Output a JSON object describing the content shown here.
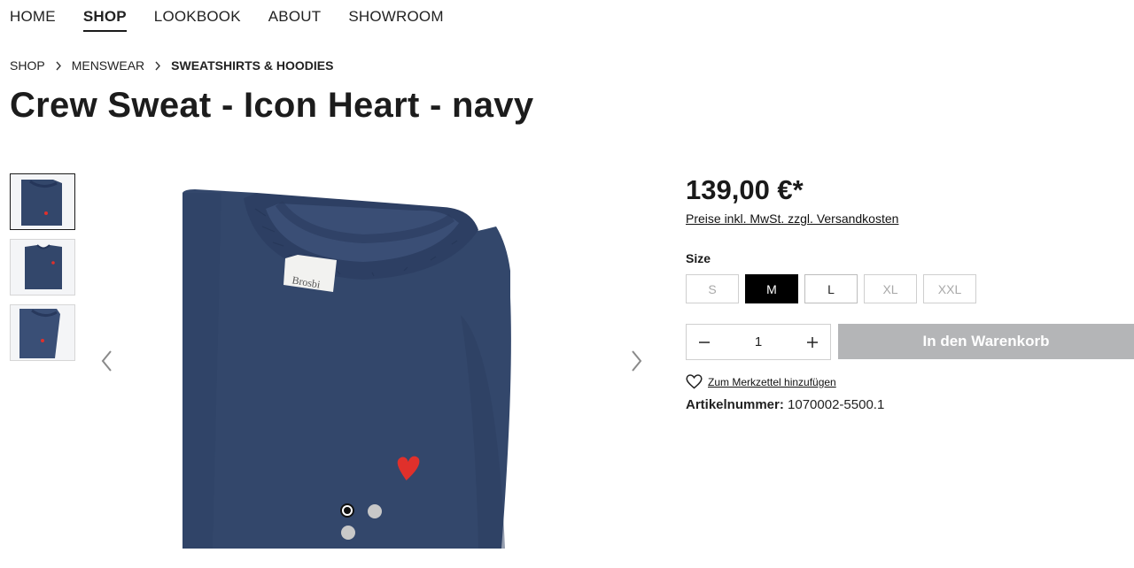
{
  "nav": {
    "items": [
      {
        "label": "HOME"
      },
      {
        "label": "SHOP",
        "active": true
      },
      {
        "label": "LOOKBOOK"
      },
      {
        "label": "ABOUT"
      },
      {
        "label": "SHOWROOM"
      }
    ]
  },
  "breadcrumb": {
    "items": [
      "SHOP",
      "MENSWEAR",
      "SWEATSHIRTS & HOODIES"
    ]
  },
  "product": {
    "title": "Crew Sweat - Icon Heart - navy",
    "price": "139,00 €*",
    "tax_note": "Preise inkl. MwSt. zzgl. Versandkosten",
    "size_label": "Size",
    "sizes": [
      {
        "label": "S",
        "state": "unavailable"
      },
      {
        "label": "M",
        "state": "selected"
      },
      {
        "label": "L",
        "state": "available"
      },
      {
        "label": "XL",
        "state": "unavailable"
      },
      {
        "label": "XXL",
        "state": "unavailable"
      }
    ],
    "quantity": "1",
    "add_to_cart_label": "In den Warenkorb",
    "wishlist_label": "Zum Merkzettel hinzufügen",
    "sku_label": "Artikelnummer:",
    "sku_value": "1070002-5500.1",
    "label_text": "Brosbi",
    "colors": {
      "navy": "#33476b",
      "heart": "#e0302b",
      "button_disabled": "#b4b5b7"
    }
  },
  "gallery": {
    "thumbnail_count": 3,
    "active_thumbnail": 1,
    "dot_count": 3,
    "active_dot": 1
  }
}
